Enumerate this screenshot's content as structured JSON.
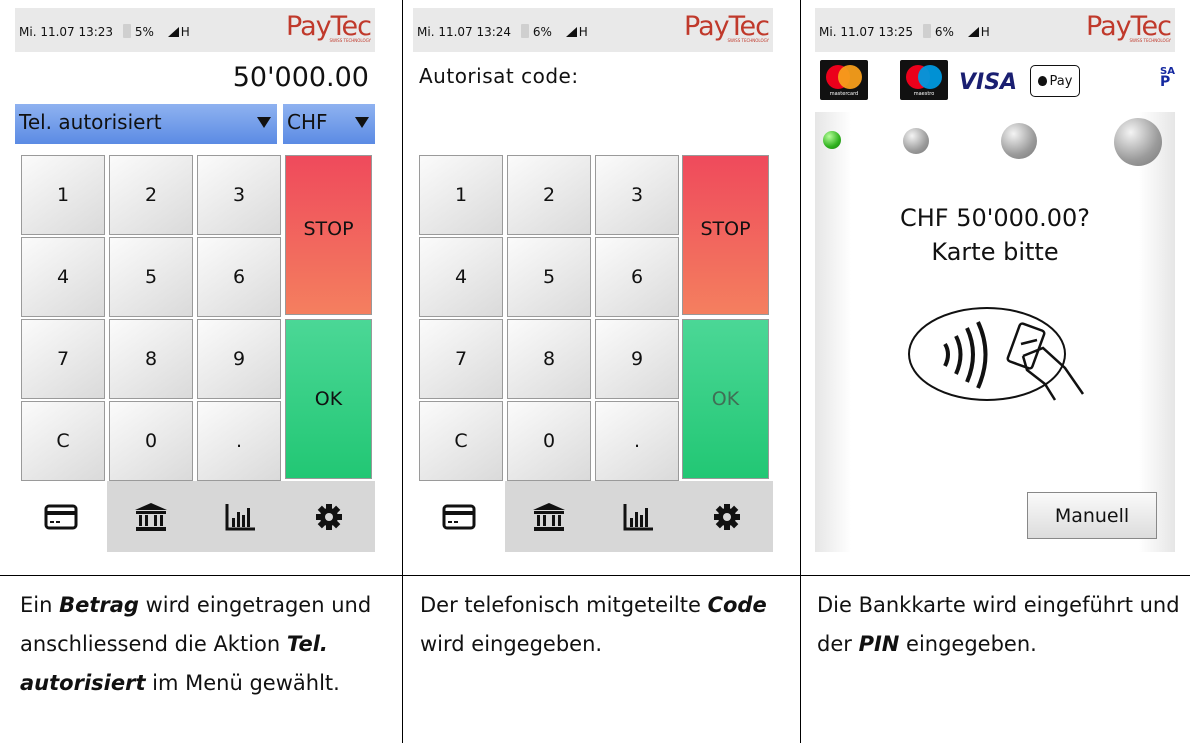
{
  "logo_text": "PayTec",
  "logo_subtext": "SWISS TECHNOLOGY",
  "colors": {
    "brand_red": "#c0392b",
    "stop_red": "#ef4a5c",
    "ok_green": "#22c774",
    "menu_blue": "#5b8be4",
    "led_green": "#2fb11e"
  },
  "keys": [
    "1",
    "2",
    "3",
    "4",
    "5",
    "6",
    "7",
    "8",
    "9",
    "C",
    "0",
    "."
  ],
  "stop_label": "STOP",
  "ok_label": "OK",
  "nav_icons": [
    "card-icon",
    "bank-icon",
    "chart-icon",
    "gear-icon"
  ],
  "panel1": {
    "status": {
      "datetime": "Mi. 11.07 13:23",
      "battery": "5%",
      "network": "H"
    },
    "amount": "50'000.00",
    "action_menu": "Tel. autorisiert",
    "currency_menu": "CHF",
    "caption": {
      "t1": "Ein ",
      "b1": "Betrag",
      "t2": " wird eingetragen und anschliessend die Aktion ",
      "b2": "Tel. autorisiert",
      "t3": " im Menü gewählt."
    }
  },
  "panel2": {
    "status": {
      "datetime": "Mi. 11.07 13:24",
      "battery": "6%",
      "network": "H"
    },
    "prompt": "Autorisat code:",
    "caption": {
      "t1": "Der telefonisch mitgeteilte ",
      "b1": "Code",
      "t2": " wird eingegeben."
    }
  },
  "panel3": {
    "status": {
      "datetime": "Mi. 11.07 13:25",
      "battery": "6%",
      "network": "H"
    },
    "card_logos": {
      "mastercard": "mastercard",
      "maestro": "maestro",
      "visa": "VISA",
      "applepay": "Pay",
      "samsung_line1": "SAM",
      "samsung_line2": "P"
    },
    "amount_prompt": "CHF 50'000.00?",
    "card_prompt": "Karte bitte",
    "manual_button": "Manuell",
    "caption": {
      "t1": "Die Bankkarte wird eingeführt und der ",
      "b1": "PIN",
      "t2": " eingegeben."
    }
  }
}
